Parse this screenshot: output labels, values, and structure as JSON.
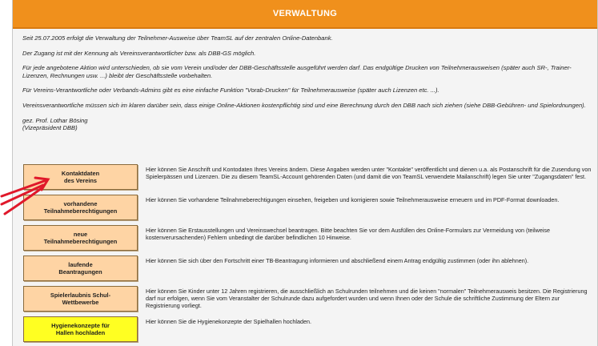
{
  "header": {
    "title": "VERWALTUNG"
  },
  "intro": {
    "p1": "Seit 25.07.2005 erfolgt die Verwaltung der Teilnehmer-Ausweise über TeamSL auf der zentralen Online-Datenbank.",
    "p2": "Der Zugang ist mit der Kennung als Vereinsverantwortlicher bzw. als DBB-GS möglich.",
    "p3": "Für jede angebotene Aktion wird unterschieden, ob sie vom Verein und/oder der DBB-Geschäftsstelle ausgeführt werden darf. Das endgültige Drucken von Teilnehmerausweisen (später auch SR-, Trainer-Lizenzen, Rechnungen usw. ...) bleibt der Geschäftsstelle vorbehalten.",
    "p4": "Für Vereins-Verantwortliche oder Verbands-Admins gibt es eine einfache Funktion \"Vorab-Drucken\" für Teilnehmerausweise (später auch Lizenzen etc. ...).",
    "p5": "Vereinsverantwortliche müssen sich im klaren darüber sein, dass einige Online-Aktionen kostenpflichtig sind und eine Berechnung durch den DBB nach sich ziehen (siehe DBB-Gebühren- und Spielordnungen).",
    "sig_name": "gez. Prof. Lothar Bösing",
    "sig_role": "(Vizepräsident DBB)"
  },
  "actions": [
    {
      "label1": "Kontaktdaten",
      "label2": "des Vereins",
      "desc": "Hier können Sie Anschrift und Kontodaten Ihres Vereins ändern. Diese Angaben werden unter \"Kontakte\" veröffentlicht und dienen u.a. als Postanschrift für die Zusendung von Spielerpässen und Lizenzen. Die zu diesem TeamSL-Account gehörenden Daten (und damit die von TeamSL verwendete Mailanschrift) legen Sie unter \"Zugangsdaten\" fest."
    },
    {
      "label1": "vorhandene",
      "label2": "Teilnahmeberechtigungen",
      "desc": "Hier können Sie vorhandene Teilnahmeberechtigungen einsehen, freigeben und korrigieren sowie Teilnehmerausweise erneuern und im PDF-Format downloaden."
    },
    {
      "label1": "neue",
      "label2": "Teilnahmeberechtigungen",
      "desc": "Hier können Sie Erstausstellungen und Vereinswechsel beantragen. Bitte beachten Sie vor dem Ausfüllen des Online-Formulars zur Vermeidung von (teilweise kostenverursachenden) Fehlern unbedingt die darüber befindlichen 10 Hinweise."
    },
    {
      "label1": "laufende",
      "label2": "Beantragungen",
      "desc": "Hier können Sie sich über den Fortschritt einer TB-Beantragung informieren und abschließend einem Antrag endgültig zustimmen (oder ihn ablehnen)."
    },
    {
      "label1": "Spielerlaubnis Schul-",
      "label2": "Wettbewerbe",
      "desc": "Hier können Sie Kinder unter 12 Jahren registrieren, die ausschließlich an Schulrunden teilnehmen und die keinen \"normalen\" Teilnehmerausweis besitzen. Die Registrierung darf nur erfolgen, wenn Sie vom Veranstalter der Schulrunde dazu aufgefordert wurden und wenn Ihnen oder der Schule die schriftliche Zustimmung der Eltern zur Registrierung vorliegt."
    },
    {
      "label1": "Hygienekonzepte für",
      "label2": "Hallen hochladen",
      "desc": "Hier können Sie die Hygienekonzepte der Spielhallen hochladen."
    }
  ],
  "colors": {
    "header": "#f0901c",
    "button": "#fed4a4",
    "button_highlight": "#ffff22",
    "arrow": "#e0182a"
  }
}
